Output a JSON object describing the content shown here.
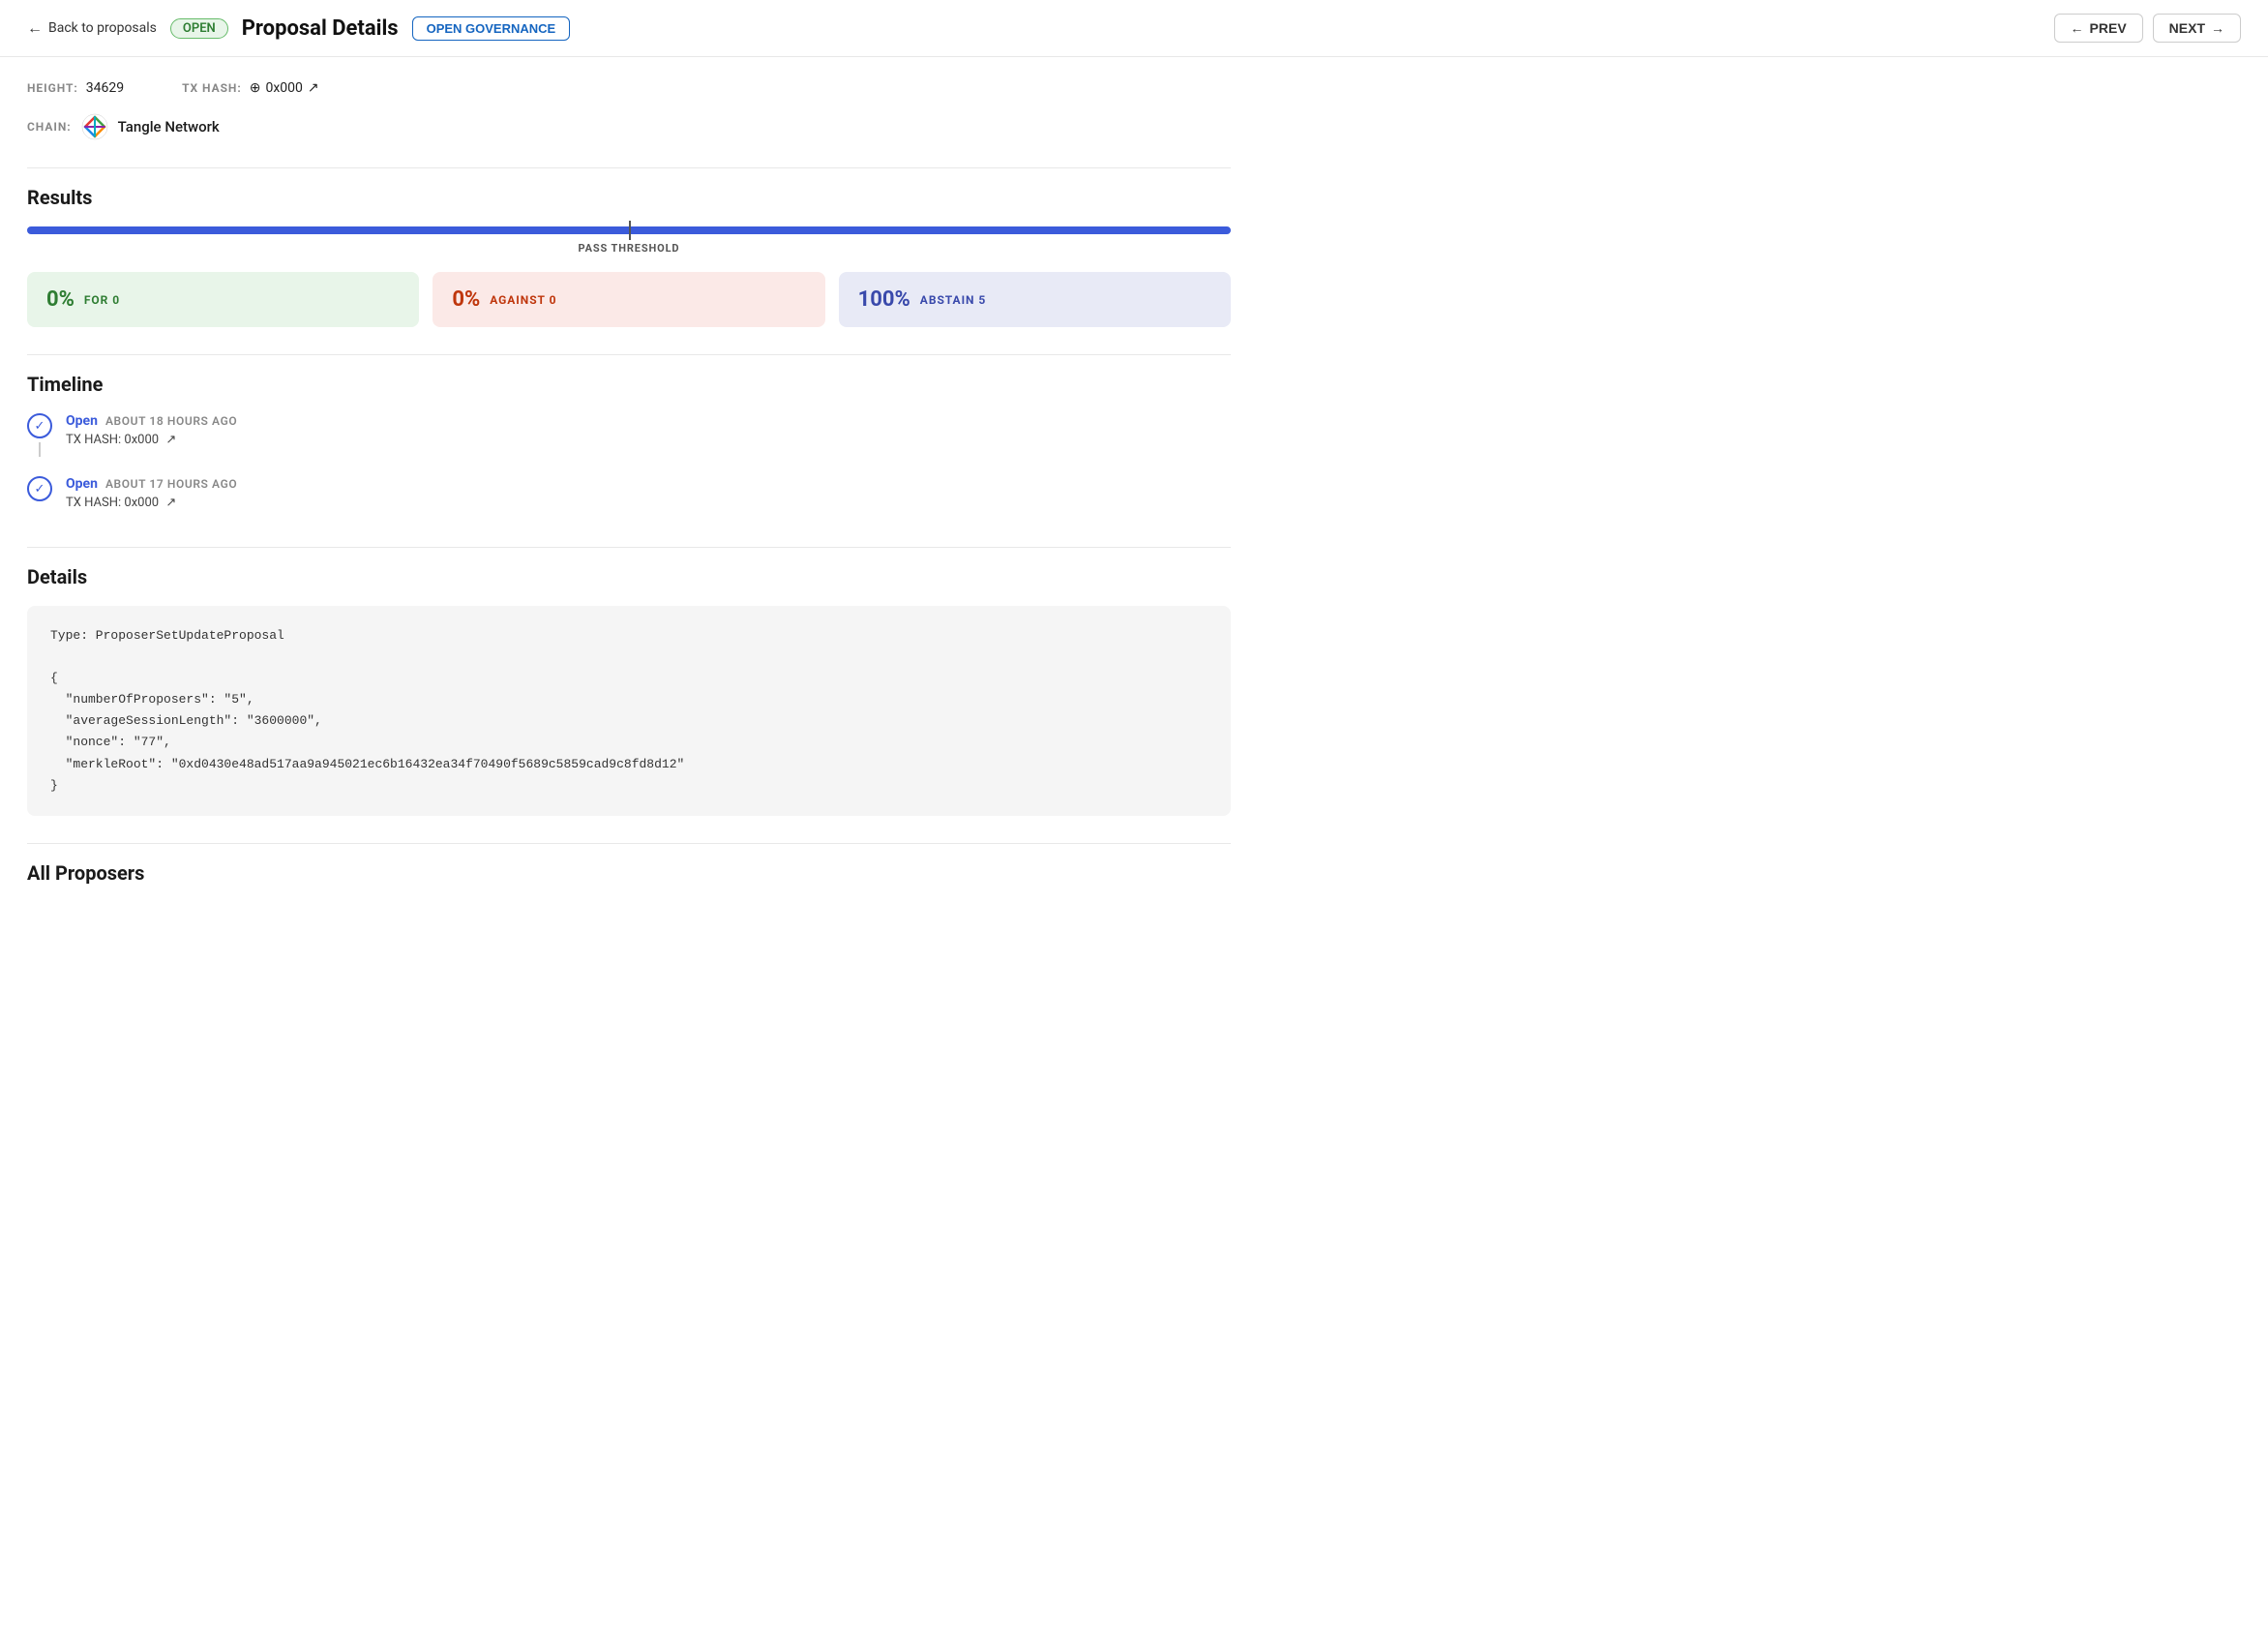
{
  "header": {
    "back_label": "Back to proposals",
    "open_badge": "OPEN",
    "page_title": "Proposal Details",
    "governance_label": "OPEN GOVERNANCE",
    "prev_label": "PREV",
    "next_label": "NEXT"
  },
  "meta": {
    "height_label": "HEIGHT:",
    "height_value": "34629",
    "tx_hash_label": "TX HASH:",
    "tx_hash_value": "0x000",
    "chain_label": "CHAIN:",
    "chain_name": "Tangle Network"
  },
  "results": {
    "section_title": "Results",
    "threshold_label": "PASS THRESHOLD",
    "for_percent": "0%",
    "for_label": "FOR 0",
    "against_percent": "0%",
    "against_label": "AGAINST 0",
    "abstain_percent": "100%",
    "abstain_label": "ABSTAIN 5"
  },
  "timeline": {
    "section_title": "Timeline",
    "items": [
      {
        "status": "Open",
        "time": "ABOUT 18 HOURS AGO",
        "tx_label": "TX HASH:",
        "tx_value": "0x000"
      },
      {
        "status": "Open",
        "time": "ABOUT 17 HOURS AGO",
        "tx_label": "TX HASH:",
        "tx_value": "0x000"
      }
    ]
  },
  "details": {
    "section_title": "Details",
    "code": "Type: ProposerSetUpdateProposal\n\n{\n  \"numberOfProposers\": \"5\",\n  \"averageSessionLength\": \"3600000\",\n  \"nonce\": \"77\",\n  \"merkleRoot\": \"0xd0430e48ad517aa9a945021ec6b16432ea34f70490f5689c5859cad9c8fd8d12\"\n}"
  },
  "all_proposers": {
    "section_title": "All Proposers"
  },
  "icons": {
    "back_arrow": "←",
    "circle_check": "✓",
    "external_link": "↗",
    "tx_icon": "⊕",
    "prev_arrow": "←",
    "next_arrow": "→"
  }
}
